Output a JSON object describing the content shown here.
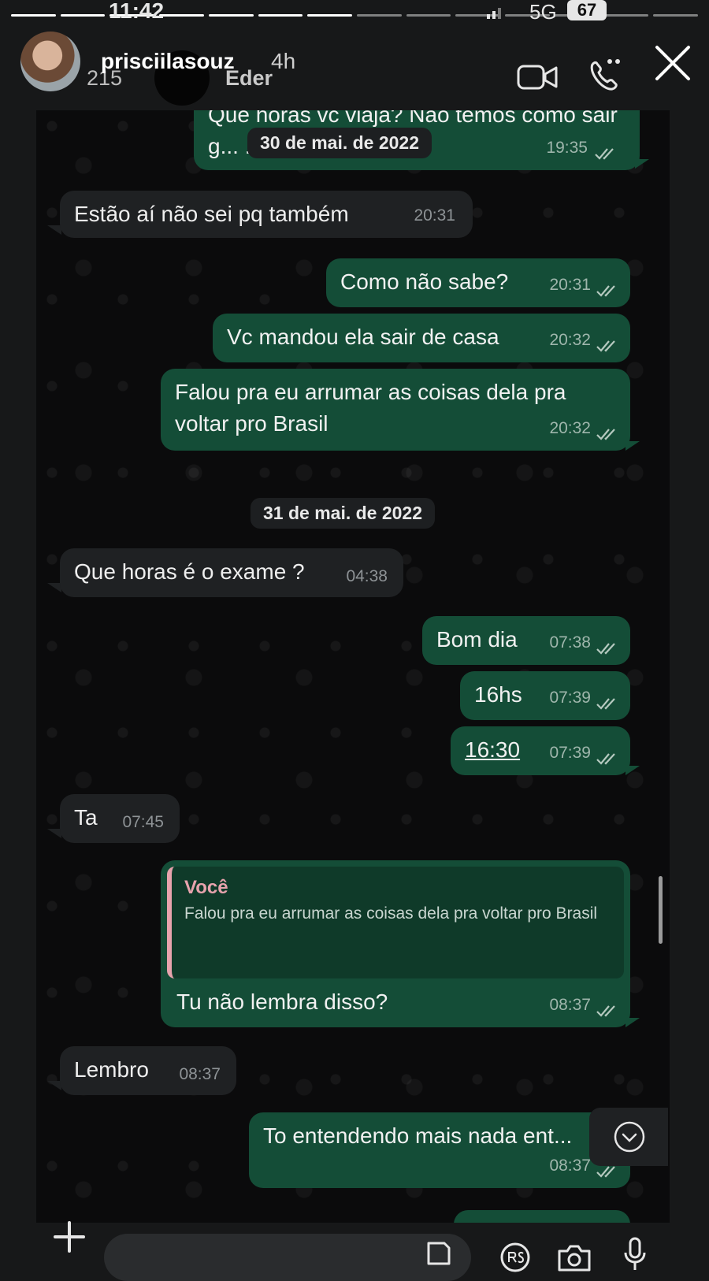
{
  "status_bar": {
    "time": "11:42",
    "network": "5G",
    "battery": "67"
  },
  "story": {
    "username": "prisciilasouz",
    "age": "4h"
  },
  "chat_header": {
    "count": "215",
    "contact_name": "Eder"
  },
  "dates": {
    "first": "30 de mai. de 2022",
    "second": "31 de mai. de 2022"
  },
  "messages": [
    {
      "dir": "out",
      "text": "Que horas vc viaja? Não temos como sair g... ...arde",
      "time": "19:35"
    },
    {
      "dir": "in",
      "text": "Estão aí não sei pq também",
      "time": "20:31"
    },
    {
      "dir": "out",
      "text": "Como não sabe?",
      "time": "20:31"
    },
    {
      "dir": "out",
      "text": "Vc mandou ela sair de casa",
      "time": "20:32"
    },
    {
      "dir": "out",
      "text": "Falou pra eu arrumar as coisas dela pra voltar pro Brasil",
      "time": "20:32"
    },
    {
      "dir": "in",
      "text": "Que horas é o exame ?",
      "time": "04:38"
    },
    {
      "dir": "out",
      "text": "Bom dia",
      "time": "07:38"
    },
    {
      "dir": "out",
      "text": "16hs",
      "time": "07:39"
    },
    {
      "dir": "out",
      "text": "16:30",
      "time": "07:39"
    },
    {
      "dir": "in",
      "text": "Ta",
      "time": "07:45"
    },
    {
      "dir": "out",
      "text": "Tu não lembra disso?",
      "time": "08:37",
      "quote_author": "Você",
      "quote_text": "Falou pra eu arrumar as coisas dela pra voltar pro Brasil"
    },
    {
      "dir": "in",
      "text": "Lembro",
      "time": "08:37"
    },
    {
      "dir": "out",
      "text": "To entendendo mais nada ent...",
      "time": "08:37"
    }
  ],
  "colors": {
    "outgoing": "#144d37",
    "incoming": "#1f2123",
    "quote_accent": "#e7a3ad",
    "background": "#0b0b0c"
  }
}
